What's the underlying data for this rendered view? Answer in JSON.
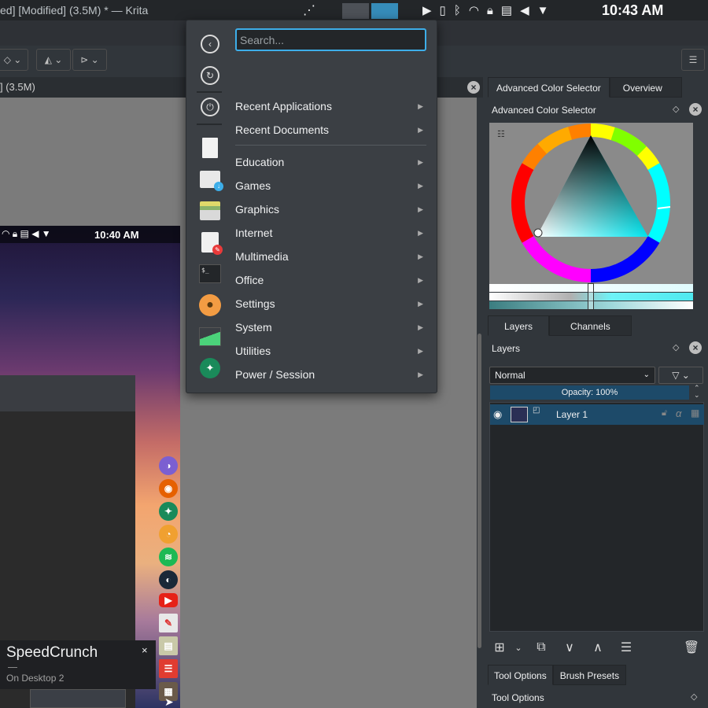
{
  "topbar": {
    "window_title": "ed] [Modified] (3.5M) * — Krita",
    "clock": "10:43 AM",
    "tray_icons": [
      "play-icon",
      "usb-icon",
      "bluetooth-icon",
      "wifi-icon",
      "lock-icon",
      "clipboard-icon",
      "volume-icon",
      "menu-arrow-icon"
    ]
  },
  "canvas": {
    "tab_title": "] (3.5M)",
    "embedded": {
      "clock": "10:40 AM",
      "tooltip_title": "SpeedCrunch",
      "tooltip_subtitle": "On Desktop 2",
      "tooltip_close": "×"
    }
  },
  "launcher": {
    "search_placeholder": "Search...",
    "sidebar_icons": [
      "back-icon",
      "refresh-icon",
      "power-icon",
      "document-icon",
      "store-icon",
      "archive-icon",
      "text-editor-icon",
      "terminal-icon",
      "user-icon",
      "system-monitor-icon",
      "settings-wrench-icon"
    ],
    "items": [
      {
        "label": "Recent Applications"
      },
      {
        "label": "Recent Documents"
      },
      {
        "label": "Education"
      },
      {
        "label": "Games"
      },
      {
        "label": "Graphics"
      },
      {
        "label": "Internet"
      },
      {
        "label": "Multimedia"
      },
      {
        "label": "Office"
      },
      {
        "label": "Settings"
      },
      {
        "label": "System"
      },
      {
        "label": "Utilities"
      },
      {
        "label": "Power / Session"
      }
    ]
  },
  "dockers": {
    "top_tabs": [
      "Advanced Color Selector",
      "Overview"
    ],
    "color_selector_title": "Advanced Color Selector",
    "layer_tabs": [
      "Layers",
      "Channels"
    ],
    "layers_title": "Layers",
    "blend_mode": "Normal",
    "opacity_label": "Opacity:  100%",
    "layer_name": "Layer 1",
    "bottom_tabs": [
      "Tool Options",
      "Brush Presets"
    ],
    "tool_options_title": "Tool Options"
  },
  "colors": {
    "accent": "#3daee9",
    "panel_bg": "#31363b",
    "selected_layer": "#1d4a69"
  }
}
